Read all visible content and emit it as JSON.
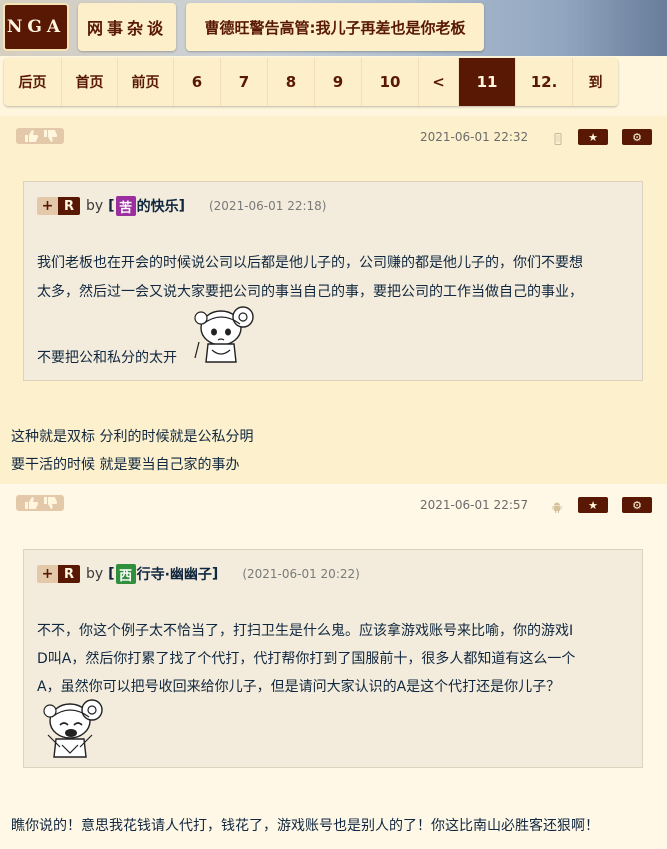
{
  "header": {
    "logo": "NGA",
    "forum": "网事杂谈",
    "topic": "曹德旺警告高管:我儿子再差也是你老板"
  },
  "pager": [
    {
      "label": "后页",
      "kind": "nav"
    },
    {
      "label": "首页",
      "kind": "nav"
    },
    {
      "label": "前页",
      "kind": "nav"
    },
    {
      "label": "6",
      "kind": "num"
    },
    {
      "label": "7",
      "kind": "num"
    },
    {
      "label": "8",
      "kind": "num"
    },
    {
      "label": "9",
      "kind": "num"
    },
    {
      "label": "10",
      "kind": "num"
    },
    {
      "label": "<",
      "kind": "num"
    },
    {
      "label": "11",
      "kind": "current"
    },
    {
      "label": "12.",
      "kind": "num"
    },
    {
      "label": "到",
      "kind": "nav"
    }
  ],
  "posts": [
    {
      "time": "2021-06-01 22:32",
      "device": "phone-icon",
      "quote": {
        "plus": "+",
        "r": "R",
        "by": "by",
        "user_badge": "苦",
        "user_rest": "的快乐",
        "badge_color": "#9b2fa0",
        "time": "(2021-06-01 22:18)",
        "lines": [
          "我们老板也在开会的时候说公司以后都是他儿子的，公司赚的都是他儿子的，你们不要想",
          "太多，然后过一会又说大家要把公司的事当自己的事，要把公司的工作当做自己的事业，",
          "不要把公和私分的太开"
        ]
      },
      "body": [
        "这种就是双标 分利的时候就是公私分明",
        "要干活的时候 就是要当自己家的事办"
      ]
    },
    {
      "time": "2021-06-01 22:57",
      "device": "android-icon",
      "quote": {
        "plus": "+",
        "r": "R",
        "by": "by",
        "user_badge": "西",
        "user_rest": "行寺·幽幽子",
        "badge_color": "#2f8f3a",
        "time": "(2021-06-01 20:22)",
        "lines": [
          "不不，你这个例子太不恰当了，打扫卫生是什么鬼。应该拿游戏账号来比喻，你的游戏I",
          "D叫A，然后你打累了找了个代打，代打帮你打到了国服前十，很多人都知道有这么一个",
          "A，虽然你可以把号收回来给你儿子，但是请问大家认识的A是这个代打还是你儿子？"
        ]
      },
      "body": [
        "瞧你说的！意思我花钱请人代打，钱花了，游戏账号也是别人的了！你这比南山必胜客还狠啊！"
      ]
    }
  ],
  "icons": {
    "star": "★",
    "gear": "⚙"
  },
  "colors": {
    "brand": "#591804",
    "post_bg_1": "#fdf0cd",
    "post_bg_2": "#fff8e7",
    "quote_bg": "#f3ecdc"
  }
}
